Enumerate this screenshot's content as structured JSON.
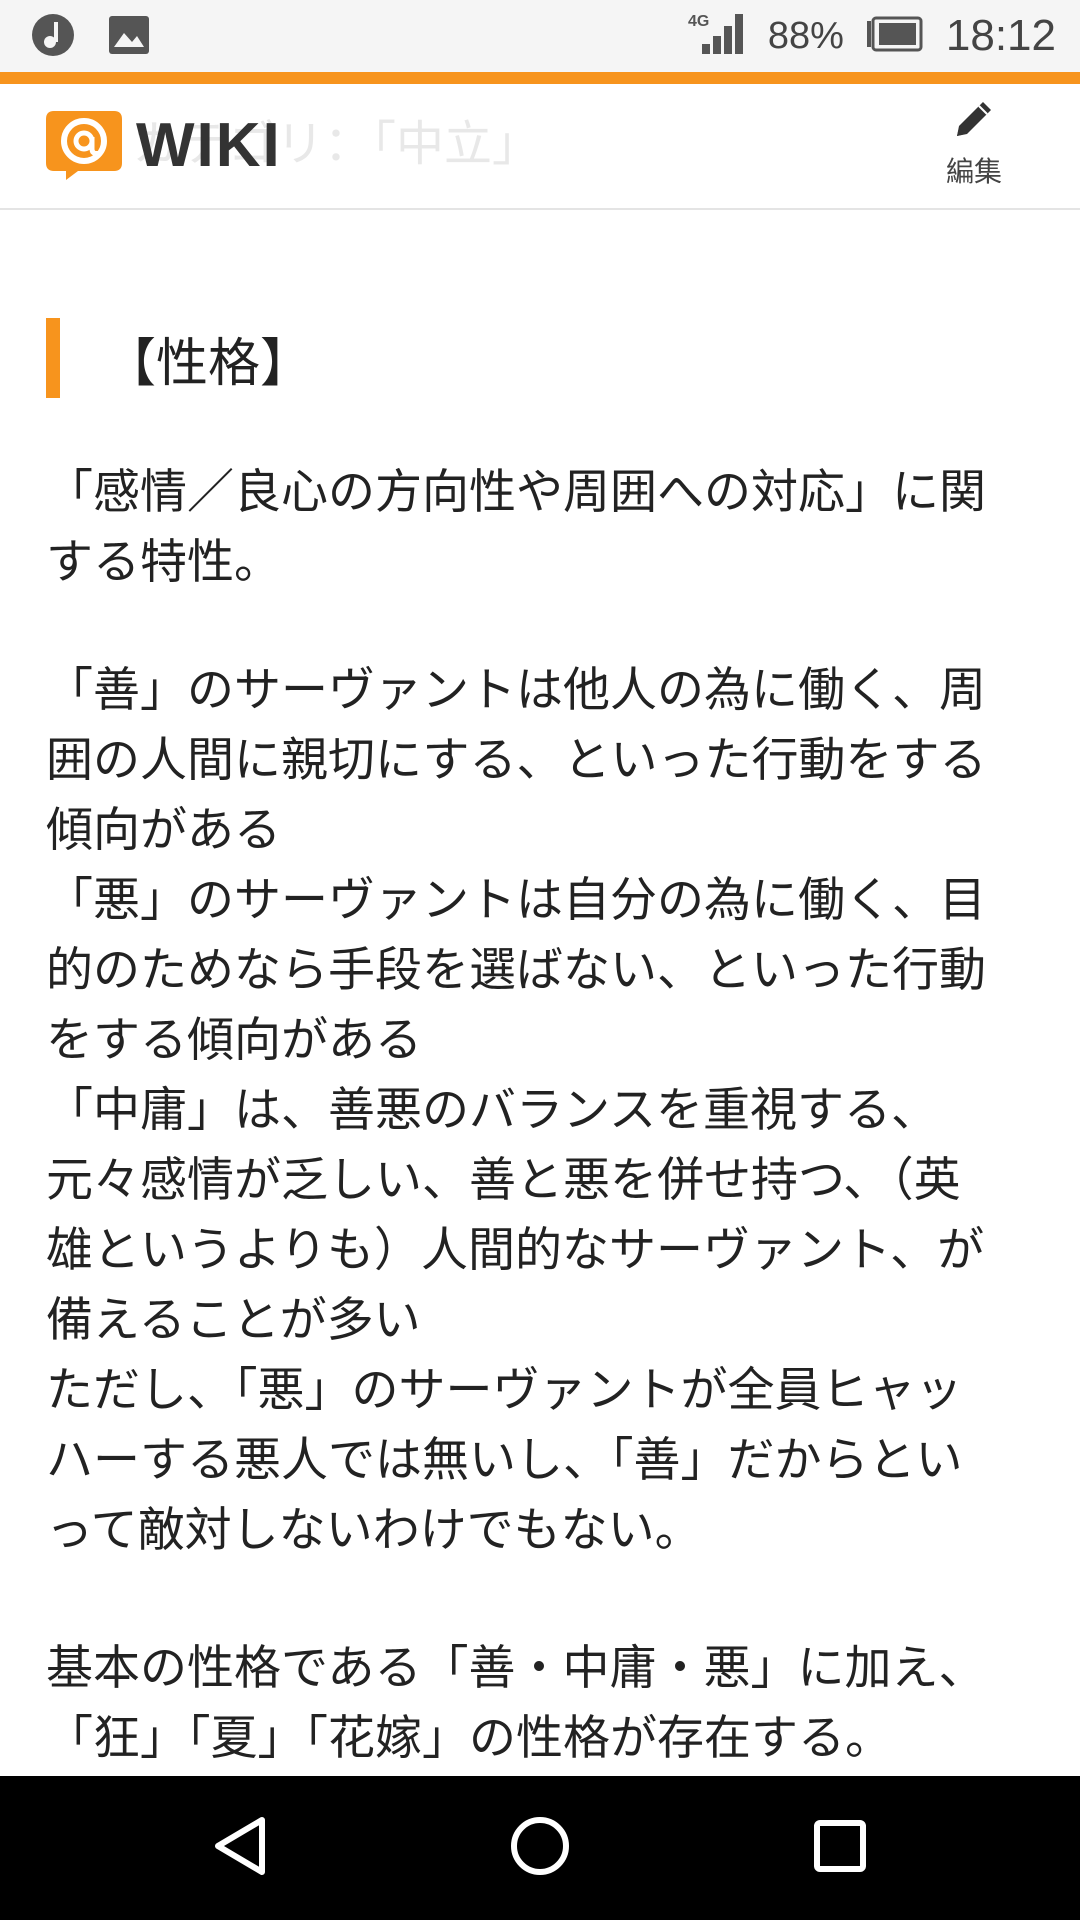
{
  "status_bar": {
    "network": "4G",
    "battery": "88%",
    "time": "18:12",
    "left_icons": [
      "music-note-icon",
      "image-icon"
    ]
  },
  "colors": {
    "accent": "#f7941d",
    "nav_bg": "#000000"
  },
  "header": {
    "logo_text": "WIKI",
    "ghost_title": "カテゴリ：「中立」",
    "edit_label": "編集"
  },
  "section": {
    "heading": "【性格】"
  },
  "paragraphs": [
    [
      "「感情／良心の方向性や周囲への対応」に関",
      "する特性。"
    ],
    [
      "「善」のサーヴァントは他人の為に働く、周",
      "囲の人間に親切にする、といった行動をする",
      "傾向がある",
      "「悪」のサーヴァントは自分の為に働く、目",
      "的のためなら手段を選ばない、といった行動",
      "をする傾向がある",
      "「中庸」は、善悪のバランスを重視する、",
      "元々感情が乏しい、善と悪を併せ持つ、（英",
      "雄というよりも）人間的なサーヴァント、が",
      "備えることが多い",
      "ただし、「悪」のサーヴァントが全員ヒャッ",
      "ハーする悪人では無いし、「善」だからとい",
      "って敵対しないわけでもない。"
    ],
    [
      "基本の性格である「善・中庸・悪」に加え、",
      "「狂」「夏」「花嫁」の性格が存在する。"
    ]
  ],
  "nav": {
    "buttons": [
      "back-icon",
      "home-icon",
      "recents-icon"
    ]
  }
}
